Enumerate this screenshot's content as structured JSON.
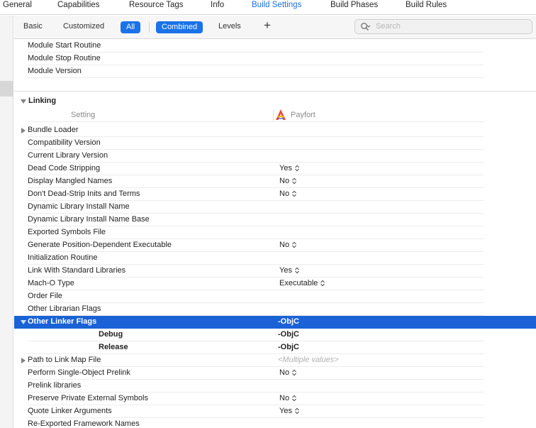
{
  "tabs": [
    {
      "label": "General",
      "active": false
    },
    {
      "label": "Capabilities",
      "active": false
    },
    {
      "label": "Resource Tags",
      "active": false
    },
    {
      "label": "Info",
      "active": false
    },
    {
      "label": "Build Settings",
      "active": true
    },
    {
      "label": "Build Phases",
      "active": false
    },
    {
      "label": "Build Rules",
      "active": false
    }
  ],
  "filter": {
    "basic": "Basic",
    "customized": "Customized",
    "all": "All",
    "combined": "Combined",
    "levels": "Levels",
    "add": "+",
    "search_placeholder": "Search"
  },
  "prev_rows": [
    {
      "label": "Module Start Routine",
      "value": ""
    },
    {
      "label": "Module Stop Routine",
      "value": ""
    },
    {
      "label": "Module Version",
      "value": ""
    }
  ],
  "section": {
    "title": "Linking",
    "column_setting": "Setting",
    "column_target": "Payfort",
    "target_icon": "app-target-icon"
  },
  "rows": [
    {
      "label": "Bundle Loader",
      "value": "",
      "expandable": true
    },
    {
      "label": "Compatibility Version",
      "value": ""
    },
    {
      "label": "Current Library Version",
      "value": ""
    },
    {
      "label": "Dead Code Stripping",
      "value": "Yes",
      "stepper": true
    },
    {
      "label": "Display Mangled Names",
      "value": "No",
      "stepper": true
    },
    {
      "label": "Don't Dead-Strip Inits and Terms",
      "value": "No",
      "stepper": true
    },
    {
      "label": "Dynamic Library Install Name",
      "value": ""
    },
    {
      "label": "Dynamic Library Install Name Base",
      "value": ""
    },
    {
      "label": "Exported Symbols File",
      "value": ""
    },
    {
      "label": "Generate Position-Dependent Executable",
      "value": "No",
      "stepper": true
    },
    {
      "label": "Initialization Routine",
      "value": ""
    },
    {
      "label": "Link With Standard Libraries",
      "value": "Yes",
      "stepper": true
    },
    {
      "label": "Mach-O Type",
      "value": "Executable",
      "stepper": true
    },
    {
      "label": "Order File",
      "value": ""
    },
    {
      "label": "Other Librarian Flags",
      "value": ""
    }
  ],
  "selected": {
    "label": "Other Linker Flags",
    "value": "-ObjC",
    "children": [
      {
        "label": "Debug",
        "value": "-ObjC"
      },
      {
        "label": "Release",
        "value": "-ObjC"
      }
    ]
  },
  "rows_after": [
    {
      "label": "Path to Link Map File",
      "value": "<Multiple values>",
      "expandable": true,
      "placeholder": true
    },
    {
      "label": "Perform Single-Object Prelink",
      "value": "No",
      "stepper": true
    },
    {
      "label": "Prelink libraries",
      "value": ""
    },
    {
      "label": "Preserve Private External Symbols",
      "value": "No",
      "stepper": true
    },
    {
      "label": "Quote Linker Arguments",
      "value": "Yes",
      "stepper": true
    },
    {
      "label": "Re-Exported Framework Names",
      "value": ""
    }
  ],
  "colors": {
    "accent": "#1a73e8",
    "selection": "#1a62d6",
    "tab_active": "#1a6fd9"
  }
}
